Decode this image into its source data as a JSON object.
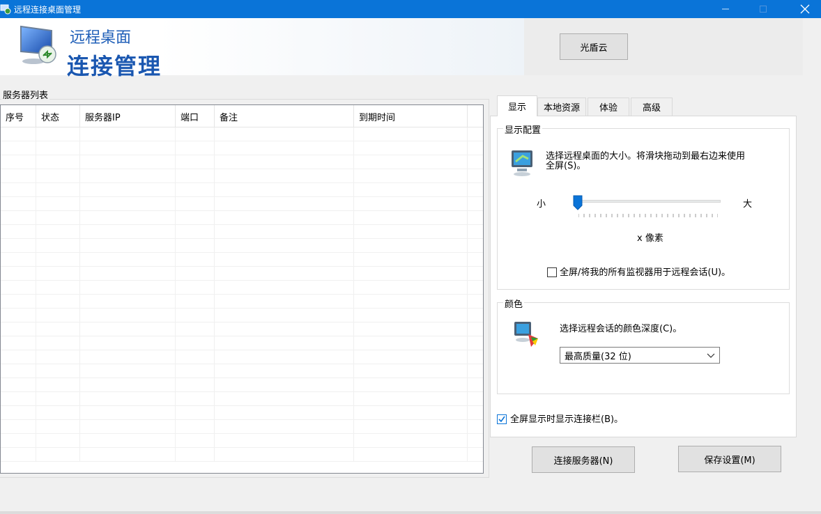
{
  "window": {
    "title": "远程连接桌面管理",
    "min_icon": "minimize-icon",
    "max_icon": "maximize-icon",
    "close_icon": "close-icon"
  },
  "banner": {
    "subtitle": "远程桌面",
    "title": "连接管理",
    "logo_icon": "remote-desktop-logo-icon",
    "cloud_button": "光盾云"
  },
  "server_list": {
    "group_label": "服务器列表",
    "columns": [
      "序号",
      "状态",
      "服务器IP",
      "端口",
      "备注",
      "到期时间"
    ],
    "row_count": 24
  },
  "tabs": [
    {
      "label": "显示",
      "active": true
    },
    {
      "label": "本地资源",
      "active": false
    },
    {
      "label": "体验",
      "active": false
    },
    {
      "label": "高级",
      "active": false
    }
  ],
  "display": {
    "group_label": "显示配置",
    "description_line1": "选择远程桌面的大小。将滑块拖动到最右边来使用",
    "description_line2": "全屏(S)。",
    "monitor_icon": "monitor-icon",
    "slider_min_label": "小",
    "slider_max_label": "大",
    "slider_value": 0,
    "resolution_text": "x 像素",
    "fullscreen_all_monitors": "全屏/将我的所有监视器用于远程会话(U)。",
    "fullscreen_all_monitors_checked": false
  },
  "color": {
    "group_label": "颜色",
    "description": "选择远程会话的颜色深度(C)。",
    "palette_icon": "color-palette-icon",
    "selected": "最高质量(32 位)"
  },
  "connection_bar": {
    "label": "全屏显示时显示连接栏(B)。",
    "checked": true
  },
  "buttons": {
    "connect": "连接服务器(N)",
    "save": "保存设置(M)"
  }
}
